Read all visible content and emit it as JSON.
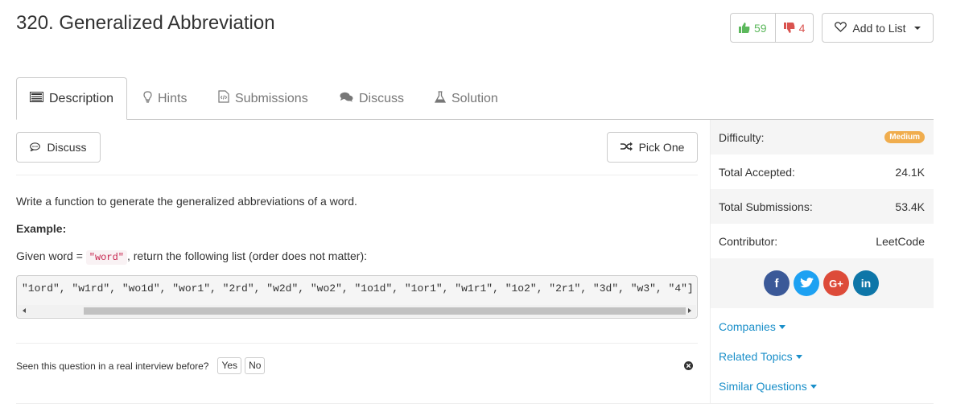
{
  "problem": {
    "title": "320. Generalized Abbreviation",
    "upvotes": "59",
    "downvotes": "4",
    "add_to_list": "Add to List"
  },
  "tabs": [
    {
      "label": "Description",
      "icon": "description-icon"
    },
    {
      "label": "Hints",
      "icon": "lightbulb-icon"
    },
    {
      "label": "Submissions",
      "icon": "code-file-icon"
    },
    {
      "label": "Discuss",
      "icon": "comments-icon"
    },
    {
      "label": "Solution",
      "icon": "flask-icon"
    }
  ],
  "actions": {
    "discuss": "Discuss",
    "pick_one": "Pick One"
  },
  "content": {
    "intro": "Write a function to generate the generalized abbreviations of a word.",
    "example_label": "Example:",
    "given_prefix": "Given word = ",
    "given_word": "\"word\"",
    "given_suffix": ", return the following list (order does not matter):",
    "code": "\"1ord\", \"w1rd\", \"wo1d\", \"wor1\", \"2rd\", \"w2d\", \"wo2\", \"1o1d\", \"1or1\", \"w1r1\", \"1o2\", \"2r1\", \"3d\", \"w3\", \"4\"]"
  },
  "interview": {
    "question": "Seen this question in a real interview before?",
    "yes": "Yes",
    "no": "No"
  },
  "sidebar": {
    "difficulty_label": "Difficulty:",
    "difficulty_value": "Medium",
    "accepted_label": "Total Accepted:",
    "accepted_value": "24.1K",
    "submissions_label": "Total Submissions:",
    "submissions_value": "53.4K",
    "contributor_label": "Contributor:",
    "contributor_value": "LeetCode",
    "companies": "Companies",
    "related_topics": "Related Topics",
    "similar_questions": "Similar Questions"
  },
  "social": {
    "facebook": "f",
    "google": "G+",
    "linkedin": "in"
  },
  "colors": {
    "upvote": "#5cb85c",
    "downvote": "#d9534f",
    "medium_badge": "#f0ad4e",
    "link": "#1a8fc9",
    "facebook": "#3b5998",
    "twitter": "#1da1f2",
    "google": "#dd4b39",
    "linkedin": "#0e76a8"
  }
}
